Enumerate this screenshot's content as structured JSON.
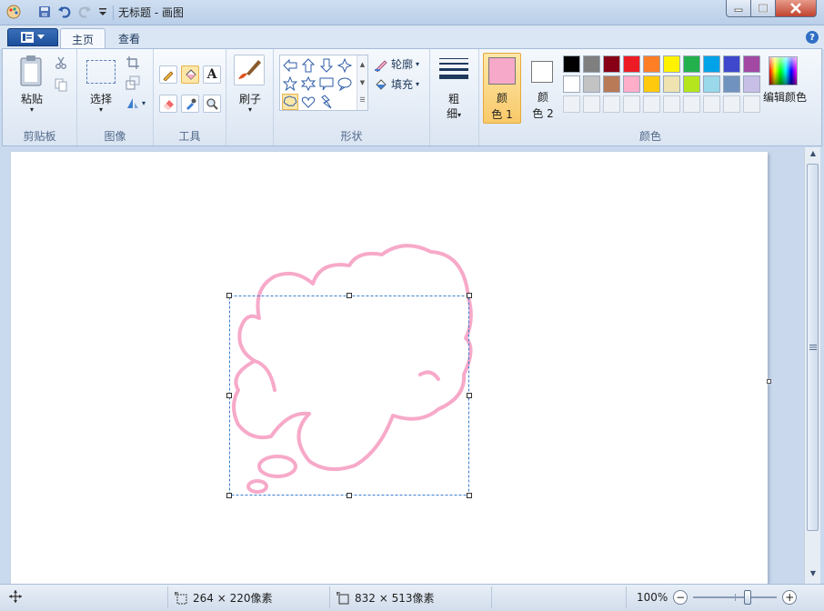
{
  "window": {
    "title": "无标题 - 画图",
    "buttons": {
      "minimize": "minimize",
      "maximize": "maximize",
      "close": "close"
    }
  },
  "tabs": [
    {
      "label": "主页",
      "active": true
    },
    {
      "label": "查看",
      "active": false
    }
  ],
  "ribbon": {
    "clipboard": {
      "group_label": "剪贴板",
      "paste_label": "粘贴"
    },
    "image": {
      "group_label": "图像",
      "select_label": "选择"
    },
    "tools": {
      "group_label": "工具",
      "text_tool_glyph": "A"
    },
    "brushes": {
      "label": "刷子"
    },
    "shapes": {
      "group_label": "形状",
      "outline_label": "轮廓",
      "fill_label": "填充"
    },
    "size": {
      "label_line1": "粗",
      "label_line2": "细"
    },
    "colors": {
      "group_label": "颜色",
      "color1_line1": "颜",
      "color1_line2": "色 1",
      "color2_line1": "颜",
      "color2_line2": "色 2",
      "color1_value": "#f7a9c9",
      "color2_value": "#ffffff",
      "edit_colors_label": "编辑颜色",
      "palette_row1": [
        "#000000",
        "#7f7f7f",
        "#880015",
        "#ed1c24",
        "#ff7f27",
        "#fff200",
        "#22b14c",
        "#00a2e8",
        "#3f48cc",
        "#a349a4"
      ],
      "palette_row2": [
        "#ffffff",
        "#c3c3c3",
        "#b97a57",
        "#ffaec9",
        "#ffc90e",
        "#efe4b0",
        "#b5e61d",
        "#99d9ea",
        "#7092be",
        "#c8bfe7"
      ]
    }
  },
  "status": {
    "selection_size": "264 × 220像素",
    "image_size": "832 × 513像素",
    "zoom": "100%",
    "zoom_out": "−",
    "zoom_in": "+"
  },
  "drawing": {
    "stroke_color": "#f7a9c9",
    "selection_color": "#3c7fd1"
  }
}
